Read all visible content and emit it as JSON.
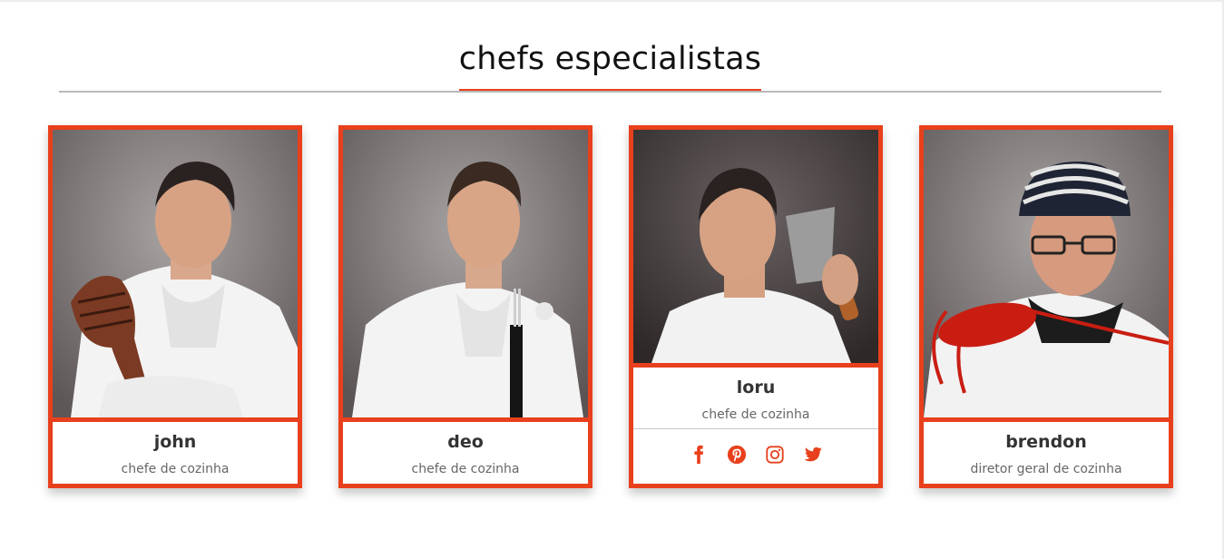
{
  "section": {
    "title": "chefs especialistas"
  },
  "chefs": [
    {
      "name": "john",
      "role": "chefe de cozinha"
    },
    {
      "name": "deo",
      "role": "chefe de cozinha"
    },
    {
      "name": "loru",
      "role": "chefe de cozinha"
    },
    {
      "name": "brendon",
      "role": "diretor geral de cozinha"
    }
  ],
  "social_icons": [
    "facebook-icon",
    "pinterest-icon",
    "instagram-icon",
    "twitter-icon"
  ],
  "colors": {
    "accent": "#e8401c",
    "title": "#111111",
    "name": "#333333",
    "role": "#666666"
  }
}
